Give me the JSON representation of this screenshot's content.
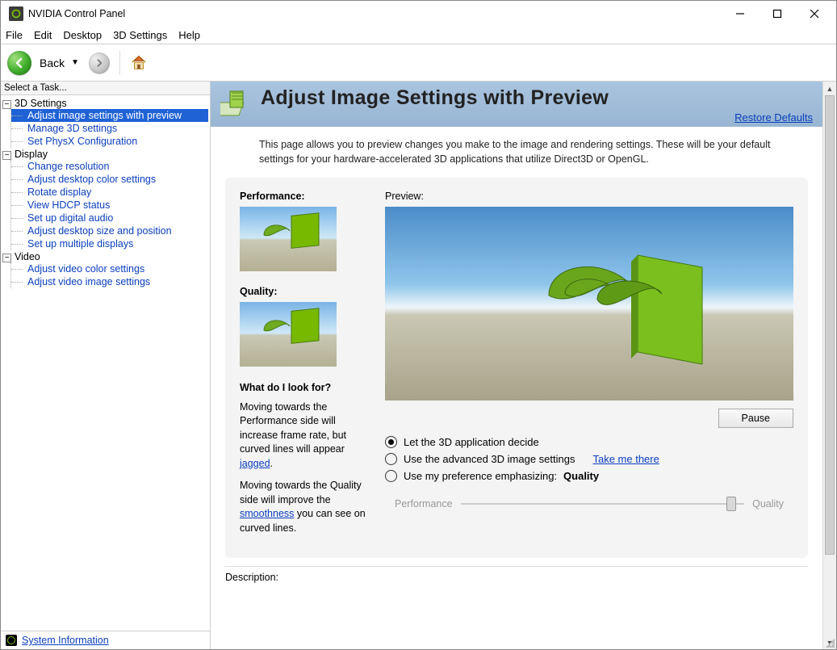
{
  "window": {
    "title": "NVIDIA Control Panel"
  },
  "menu": {
    "file": "File",
    "edit": "Edit",
    "desktop": "Desktop",
    "settings3d": "3D Settings",
    "help": "Help"
  },
  "toolbar": {
    "back_label": "Back"
  },
  "sidebar": {
    "header": "Select a Task...",
    "groups": [
      {
        "label": "3D Settings",
        "items": [
          "Adjust image settings with preview",
          "Manage 3D settings",
          "Set PhysX Configuration"
        ]
      },
      {
        "label": "Display",
        "items": [
          "Change resolution",
          "Adjust desktop color settings",
          "Rotate display",
          "View HDCP status",
          "Set up digital audio",
          "Adjust desktop size and position",
          "Set up multiple displays"
        ]
      },
      {
        "label": "Video",
        "items": [
          "Adjust video color settings",
          "Adjust video image settings"
        ]
      }
    ],
    "footer_link": "System Information"
  },
  "page": {
    "title": "Adjust Image Settings with Preview",
    "restore": "Restore Defaults",
    "description": "This page allows you to preview changes you make to the image and rendering settings. These will be your default settings for your hardware-accelerated 3D applications that utilize Direct3D or OpenGL.",
    "performance_label": "Performance:",
    "quality_label": "Quality:",
    "preview_label": "Preview:",
    "pause": "Pause",
    "options": {
      "o1": "Let the 3D application decide",
      "o2": "Use the advanced 3D image settings",
      "o2_link": "Take me there",
      "o3": "Use my preference emphasizing:",
      "o3_value": "Quality"
    },
    "slider": {
      "left": "Performance",
      "right": "Quality"
    },
    "help": {
      "heading": "What do I look for?",
      "p1a": "Moving towards the Performance side will increase frame rate, but curved lines will appear ",
      "p1_link": "jagged",
      "p1b": ".",
      "p2a": "Moving towards the Quality side will improve the ",
      "p2_link": "smoothness",
      "p2b": " you can see on curved lines."
    },
    "description_label": "Description:"
  }
}
